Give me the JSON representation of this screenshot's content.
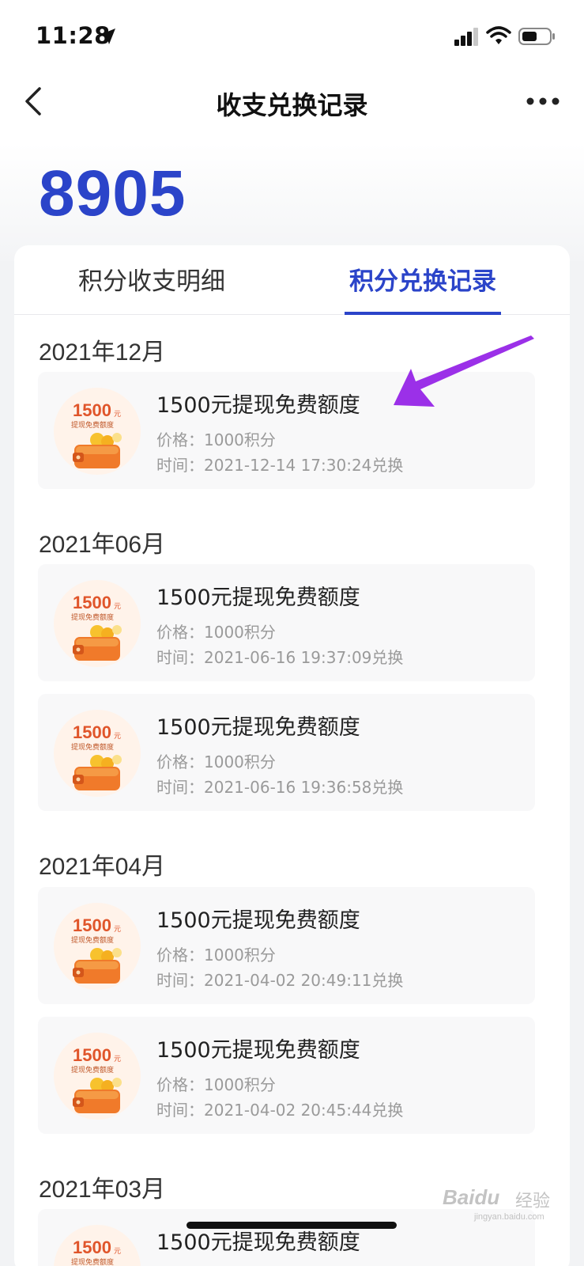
{
  "status_bar": {
    "time": "11:28"
  },
  "nav": {
    "title": "收支兑换记录"
  },
  "balance": "8905",
  "tabs": [
    {
      "label": "积分收支明细",
      "active": false
    },
    {
      "label": "积分兑换记录",
      "active": true
    }
  ],
  "record_icon": {
    "amount": "1500",
    "unit": "元",
    "caption": "提现免费额度"
  },
  "groups": [
    {
      "month": "2021年12月",
      "records": [
        {
          "title": "1500元提现免费额度",
          "price": "价格：1000积分",
          "time": "时间：2021-12-14 17:30:24兑换"
        }
      ]
    },
    {
      "month": "2021年06月",
      "records": [
        {
          "title": "1500元提现免费额度",
          "price": "价格：1000积分",
          "time": "时间：2021-06-16 19:37:09兑换"
        },
        {
          "title": "1500元提现免费额度",
          "price": "价格：1000积分",
          "time": "时间：2021-06-16 19:36:58兑换"
        }
      ]
    },
    {
      "month": "2021年04月",
      "records": [
        {
          "title": "1500元提现免费额度",
          "price": "价格：1000积分",
          "time": "时间：2021-04-02 20:49:11兑换"
        },
        {
          "title": "1500元提现免费额度",
          "price": "价格：1000积分",
          "time": "时间：2021-04-02 20:45:44兑换"
        }
      ]
    },
    {
      "month": "2021年03月",
      "records": [
        {
          "title": "1500元提现免费额度",
          "price": "",
          "time": ""
        }
      ]
    }
  ],
  "watermark": {
    "brand": "Baidu",
    "text": "经验",
    "url": "jingyan.baidu.com"
  },
  "colors": {
    "accent": "#2b44c9",
    "annotation_arrow": "#9b30e8",
    "icon_orange": "#f07a2a"
  },
  "icons": [
    "location-arrow-icon",
    "signal-icon",
    "wifi-icon",
    "battery-icon",
    "back-chevron-icon",
    "more-dots-icon",
    "wallet-coins-icon"
  ]
}
